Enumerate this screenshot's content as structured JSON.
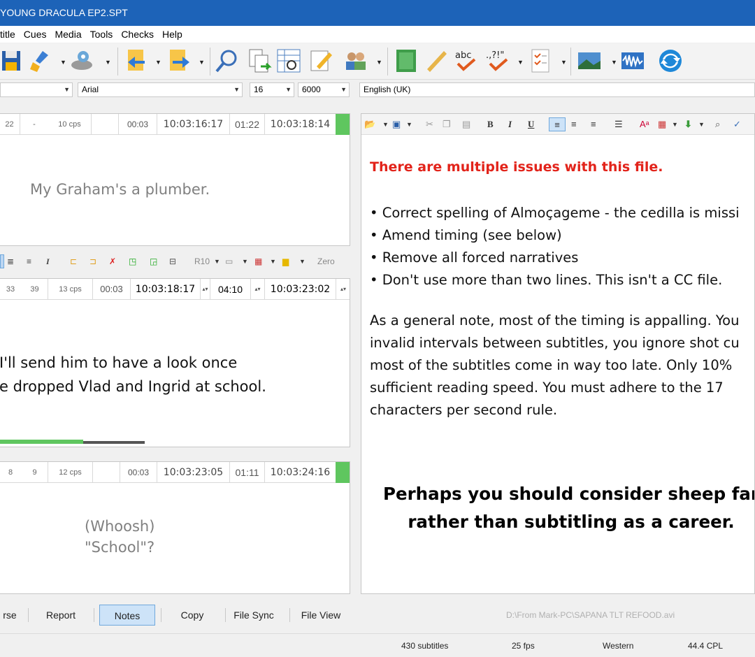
{
  "window": {
    "title": "YOUNG DRACULA EP2.SPT"
  },
  "menu": [
    "title",
    "Cues",
    "Media",
    "Tools",
    "Checks",
    "Help"
  ],
  "toolbar_icons": [
    "save-icon",
    "clean-icon",
    "disk-icon",
    "import-icon",
    "export-icon",
    "search-icon",
    "copy-icon",
    "grid-icon",
    "edit-icon",
    "users-icon",
    "book-icon",
    "ruler-icon",
    "spellcheck-icon",
    "punctuation-icon",
    "checklist-icon",
    "image-icon",
    "waveform-icon",
    "refresh-icon"
  ],
  "font_row": {
    "font": "Arial",
    "size": "16",
    "duration": "6000",
    "language": "English (UK)"
  },
  "subtitles": [
    {
      "stats": [
        "22",
        "-",
        "10 cps"
      ],
      "duration": "00:03",
      "in": "10:03:16:17",
      "gap": "01:22",
      "out": "10:03:18:14",
      "lines": [
        "My Graham's a plumber."
      ]
    },
    {
      "stats": [
        "33",
        "39",
        "13 cps"
      ],
      "duration": "00:03",
      "in": "10:03:18:17",
      "gap": "04:10",
      "out": "10:03:23:02",
      "lines": [
        "I'll send him to have a look once",
        "e dropped Vlad and Ingrid at school."
      ]
    },
    {
      "stats": [
        "8",
        "9",
        "12 cps"
      ],
      "duration": "00:03",
      "in": "10:03:23:05",
      "gap": "01:11",
      "out": "10:03:24:16",
      "lines": [
        "(Whoosh)",
        "\"School\"?"
      ]
    }
  ],
  "edit_toolbar": {
    "r10": "R10",
    "zero": "Zero"
  },
  "notes": {
    "heading": "There are multiple issues with this file.",
    "bullets": [
      "Correct spelling of Almoçageme - the cedilla is missi",
      "Amend timing (see below)",
      "Remove all forced narratives",
      "Don't use more than two lines. This isn't a CC file."
    ],
    "paragraph": [
      "As a general note, most of the timing is appalling. You",
      "invalid intervals between subtitles, you ignore shot cu",
      "most of the subtitles come in way too late. Only 10%",
      "sufficient reading speed. You must adhere to the 17",
      "characters per second rule."
    ],
    "big_lines": [
      "Perhaps you should consider sheep far",
      "rather than subtitling as a career."
    ]
  },
  "tabs": [
    "rse",
    "Report",
    "Notes",
    "Copy",
    "File Sync",
    "File View"
  ],
  "active_tab": "Notes",
  "file_path": "D:\\From Mark-PC\\SAPANA TLT REFOOD.avi",
  "status": {
    "subtitles": "430 subtitles",
    "fps": "25 fps",
    "encoding": "Western",
    "cpl": "44.4 CPL"
  },
  "colors": {
    "titlebar": "#1d63b8",
    "green": "#5fc65f",
    "red": "#e2231a",
    "active_tab": "#cde3f8"
  }
}
